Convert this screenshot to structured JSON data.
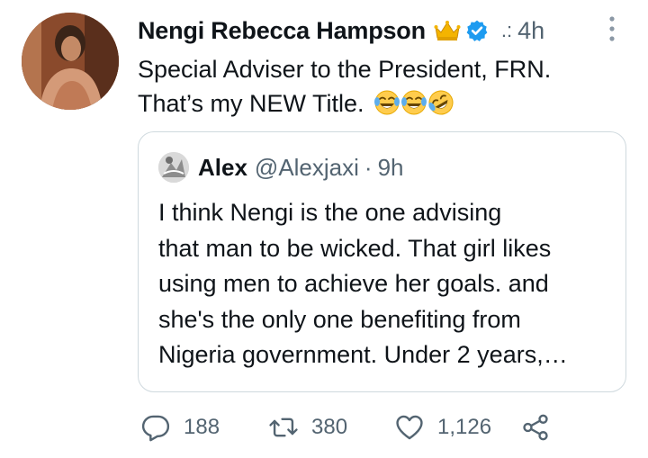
{
  "tweet": {
    "author_name": "Nengi Rebecca Hampson",
    "separator": ".:",
    "time": "4h",
    "lines": [
      "Special Adviser to the President, FRN.",
      "That’s my NEW Title."
    ],
    "emojis": [
      "face-with-tears-of-joy",
      "face-with-tears-of-joy",
      "rolling-on-floor-laughing"
    ]
  },
  "quote": {
    "author_name": "Alex",
    "handle": "@Alexjaxi",
    "dot": "·",
    "time": "9h",
    "lines": [
      "I think Nengi is the  one advising",
      "that man to be wicked. That girl likes",
      "using men to achieve her goals. and",
      "she's the only one benefiting from",
      "Nigeria government. Under 2 years,…"
    ]
  },
  "actions": {
    "replies": "188",
    "retweets": "380",
    "likes": "1,126"
  },
  "colors": {
    "text": "#0f1419",
    "muted": "#536471",
    "border": "#cfd9de",
    "verified": "#1d9bf0",
    "crown": "#f4b400"
  }
}
